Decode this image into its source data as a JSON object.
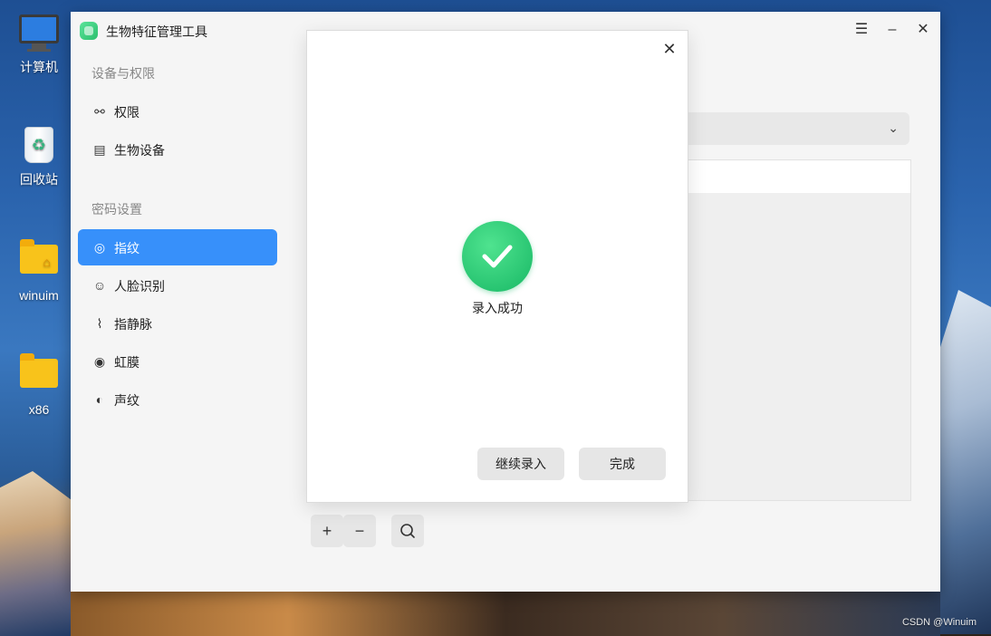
{
  "desktop": {
    "icons": [
      {
        "label": "计算机"
      },
      {
        "label": "回收站"
      },
      {
        "label": "winuim"
      },
      {
        "label": "x86"
      }
    ],
    "watermark": "CSDN @Winuim"
  },
  "window": {
    "title": "生物特征管理工具",
    "controls": {
      "menu": "☰",
      "minimize": "–",
      "close": "✕"
    }
  },
  "sidebar": {
    "section1_title": "设备与权限",
    "section1_items": [
      {
        "label": "权限",
        "icon": "permission-icon"
      },
      {
        "label": "生物设备",
        "icon": "device-icon"
      }
    ],
    "section2_title": "密码设置",
    "section2_items": [
      {
        "label": "指纹",
        "icon": "fingerprint-icon",
        "active": true
      },
      {
        "label": "人脸识别",
        "icon": "face-scan-icon"
      },
      {
        "label": "指静脉",
        "icon": "finger-vein-icon"
      },
      {
        "label": "虹膜",
        "icon": "iris-icon"
      },
      {
        "label": "声纹",
        "icon": "voiceprint-icon"
      }
    ]
  },
  "toolbar": {
    "add": "+",
    "remove": "−",
    "search": "search-icon"
  },
  "dialog": {
    "status_text": "录入成功",
    "continue_button": "继续录入",
    "done_button": "完成"
  },
  "colors": {
    "accent": "#3790fa",
    "success": "#22c06e"
  }
}
